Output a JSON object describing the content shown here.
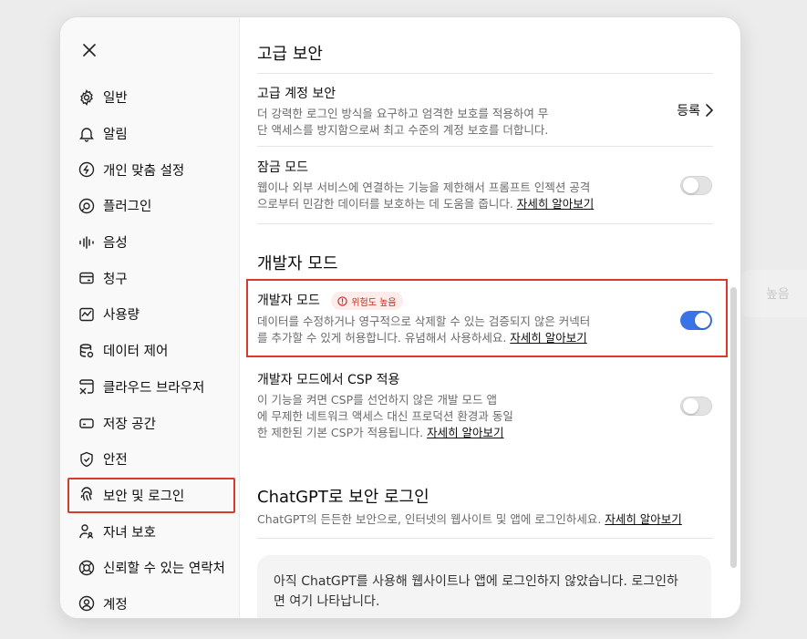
{
  "background": {
    "chip_label": "높음"
  },
  "sidebar": {
    "items": [
      {
        "label": "일반",
        "icon": "gear-icon"
      },
      {
        "label": "알림",
        "icon": "bell-icon"
      },
      {
        "label": "개인 맞춤 설정",
        "icon": "personalize-icon"
      },
      {
        "label": "플러그인",
        "icon": "plugin-icon"
      },
      {
        "label": "음성",
        "icon": "voice-icon"
      },
      {
        "label": "청구",
        "icon": "card-icon"
      },
      {
        "label": "사용량",
        "icon": "usage-icon"
      },
      {
        "label": "데이터 제어",
        "icon": "database-icon"
      },
      {
        "label": "클라우드 브라우저",
        "icon": "cloud-browser-icon"
      },
      {
        "label": "저장 공간",
        "icon": "storage-icon"
      },
      {
        "label": "안전",
        "icon": "shield-icon"
      },
      {
        "label": "보안 및 로그인",
        "icon": "fingerprint-icon",
        "active": true
      },
      {
        "label": "자녀 보호",
        "icon": "parent-icon"
      },
      {
        "label": "신뢰할 수 있는 연락처",
        "icon": "lifebuoy-icon"
      },
      {
        "label": "계정",
        "icon": "account-icon"
      }
    ]
  },
  "advanced": {
    "title": "고급 보안",
    "account_security": {
      "title": "고급 계정 보안",
      "desc_line1": "더 강력한 로그인 방식을 요구하고 엄격한 보호를 적용하여 무",
      "desc_line2": "단 액세스를 방지함으로써 최고 수준의 계정 보호를 더합니다.",
      "action": "등록"
    },
    "lock_mode": {
      "title": "잠금 모드",
      "desc_line1": "웹이나 외부 서비스에 연결하는 기능을 제한해서 프롬프트 인젝션 공격",
      "desc_line2": "으로부터 민감한 데이터를 보호하는 데 도움을 줍니다.",
      "link": "자세히 알아보기",
      "enabled": false
    }
  },
  "developer": {
    "title": "개발자 모드",
    "dev_mode": {
      "title": "개발자 모드",
      "badge": "위험도 높음",
      "desc_line1": "데이터를 수정하거나 영구적으로 삭제할 수 있는 검증되지 않은 커넥터",
      "desc_line2": "를 추가할 수 있게 허용합니다. 유념해서 사용하세요.",
      "link": "자세히 알아보기",
      "enabled": true
    },
    "csp": {
      "title": "개발자 모드에서 CSP 적용",
      "desc_line1": "이 기능을 켜면 CSP를 선언하지 않은 개발 모드 앱",
      "desc_line2": "에 무제한 네트워크 액세스 대신 프로덕션 환경과 동일",
      "desc_line3": "한 제한된 기본 CSP가 적용됩니다.",
      "link": "자세히 알아보기",
      "enabled": false
    }
  },
  "chatgpt_login": {
    "title": "ChatGPT로 보안 로그인",
    "desc": "ChatGPT의 든든한 보안으로, 인터넷의 웹사이트 및 앱에 로그인하세요.",
    "link": "자세히 알아보기",
    "empty_line1": "아직 ChatGPT를 사용해 웹사이트나 앱에 로그인하지 않았습니다. 로그인하",
    "empty_line2": "면 여기 나타납니다."
  },
  "colors": {
    "accent": "#3a73e8",
    "highlight": "#d93a2b",
    "danger": "#c5281c"
  }
}
